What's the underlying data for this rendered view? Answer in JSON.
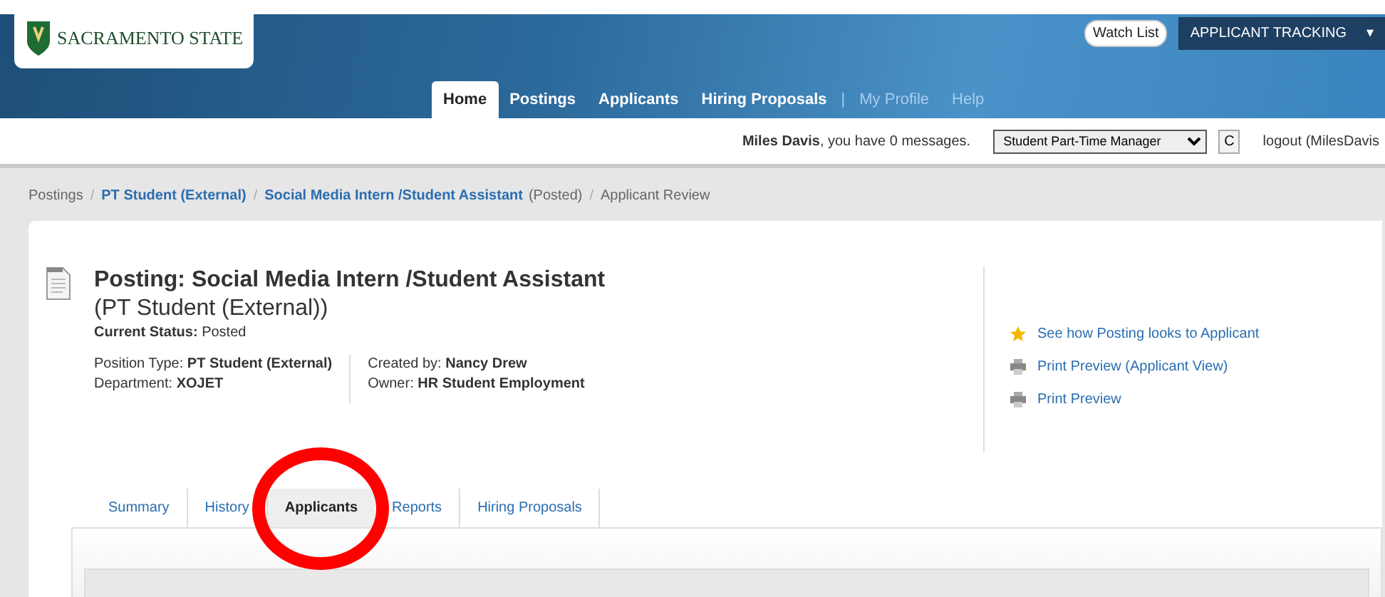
{
  "header": {
    "logo_text": "SACRAMENTO STATE",
    "watch_list": "Watch List",
    "module_menu": {
      "label": "APPLICANT TRACKING",
      "caret": "▾"
    }
  },
  "nav": [
    {
      "label": "Home",
      "selected": true,
      "kind": "main"
    },
    {
      "label": "Postings",
      "selected": false,
      "kind": "main"
    },
    {
      "label": "Applicants",
      "selected": false,
      "kind": "main"
    },
    {
      "label": "Hiring Proposals",
      "selected": false,
      "kind": "main"
    },
    {
      "label": "|",
      "selected": false,
      "kind": "separator"
    },
    {
      "label": "My Profile",
      "selected": false,
      "kind": "secondary"
    },
    {
      "label": "Help",
      "selected": false,
      "kind": "secondary"
    }
  ],
  "user_bar": {
    "message": "**Miles Davis**, you have 0 messages.",
    "role": "Student Part-Time Manager",
    "refresh": "C",
    "logout": "logout (MilesDavis"
  },
  "breadcrumb": [
    {
      "label": "Postings",
      "link": false
    },
    {
      "label": "/",
      "link": false,
      "kind": "separator"
    },
    {
      "label": "PT Student (External)",
      "link": true
    },
    {
      "label": "/",
      "link": false,
      "kind": "separator"
    },
    {
      "label": "Social Media Intern /Student Assistant",
      "link": true,
      "suffix": "(Posted)"
    },
    {
      "label": "/",
      "link": false,
      "kind": "separator"
    },
    {
      "label": "Applicant Review",
      "link": false
    }
  ],
  "posting": {
    "title": "**Posting: Social Media Intern /Student Assistant** (PT Student (External))",
    "status": "**Current Status:** Posted",
    "details_left": [
      "Position Type: **PT Student (External)**",
      "Department: **XOJET**"
    ],
    "details_right": [
      "Created by: **Nancy Drew**",
      "Owner: **HR Student Employment**"
    ]
  },
  "actions": [
    {
      "label": "See how Posting looks to Applicant",
      "kind": "star"
    },
    {
      "label": "Print Preview (Applicant View)",
      "kind": "print"
    },
    {
      "label": "Print Preview",
      "kind": "print"
    }
  ],
  "tabs": [
    {
      "label": "Summary",
      "selected": false,
      "circled": false
    },
    {
      "label": "History",
      "selected": false,
      "circled": false
    },
    {
      "label": "Applicants",
      "selected": true,
      "circled": true
    },
    {
      "label": "Reports",
      "selected": false,
      "circled": false
    },
    {
      "label": "Hiring Proposals",
      "selected": false,
      "circled": false
    }
  ]
}
